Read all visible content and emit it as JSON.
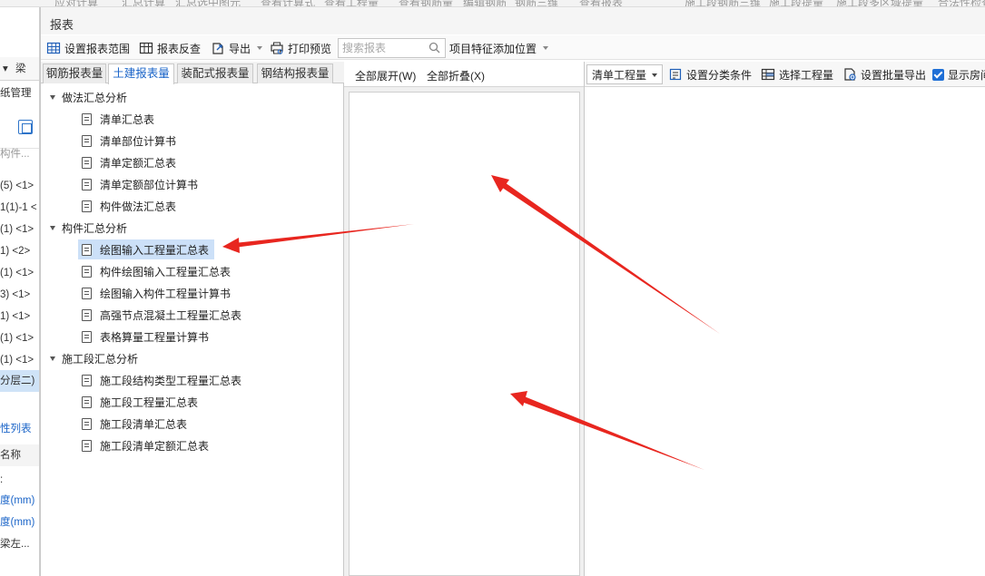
{
  "background": {
    "top_menu": [
      "应对计算",
      "汇总计算",
      "汇总选中图元",
      "查看计算式",
      "查看工程量",
      "查看钢筋量",
      "编辑钢筋",
      "钢筋三维",
      "查看报表",
      "施工段钢筋三维",
      "施工段提量",
      "施工段多区域提量",
      "合法性检查"
    ],
    "left_tab": "梁",
    "left_label": "纸管理",
    "left_search": "构件...",
    "left_items": [
      "(5) <1>",
      "1(1)-1 <",
      "(1) <1>",
      "1) <2>",
      "(1) <1>",
      "3) <1>",
      "1) <1>",
      "(1) <1>",
      "(1) <1>",
      "分层二)"
    ],
    "left_link": "性列表",
    "left_header": "名称",
    "left_props": [
      "度(mm)",
      "度(mm)",
      "梁左..."
    ]
  },
  "dialog": {
    "title": "报表",
    "toolbar": {
      "set_range": "设置报表范围",
      "report_check": "报表反查",
      "export": "导出",
      "print_preview": "打印预览",
      "search_placeholder": "搜索报表",
      "add_position": "项目特征添加位置"
    },
    "tabs": [
      "钢筋报表量",
      "土建报表量",
      "装配式报表量",
      "钢结构报表量"
    ],
    "active_tab": "土建报表量",
    "tree": [
      {
        "group": "做法汇总分析",
        "items": [
          "清单汇总表",
          "清单部位计算书",
          "清单定额汇总表",
          "清单定额部位计算书",
          "构件做法汇总表"
        ]
      },
      {
        "group": "构件汇总分析",
        "items": [
          "绘图输入工程量汇总表",
          "构件绘图输入工程量汇总表",
          "绘图输入构件工程量计算书",
          "高强节点混凝土工程量汇总表",
          "表格算量工程量计算书"
        ]
      },
      {
        "group": "施工段汇总分析",
        "items": [
          "施工段结构类型工程量汇总表",
          "施工段工程量汇总表",
          "施工段清单汇总表",
          "施工段清单定额汇总表"
        ]
      }
    ],
    "selected_item": "绘图输入工程量汇总表",
    "middle": {
      "expand_all": "全部展开(W)",
      "collapse_all": "全部折叠(X)"
    },
    "right": {
      "dropdown": "清单工程量",
      "set_category": "设置分类条件",
      "select_quantity": "选择工程量",
      "batch_export": "设置批量导出",
      "show_room": "显示房间",
      "show_room_checked": true
    }
  },
  "colors": {
    "accent": "#1a64c8",
    "selection": "#cce0f8",
    "arrow": "#e8261f"
  }
}
